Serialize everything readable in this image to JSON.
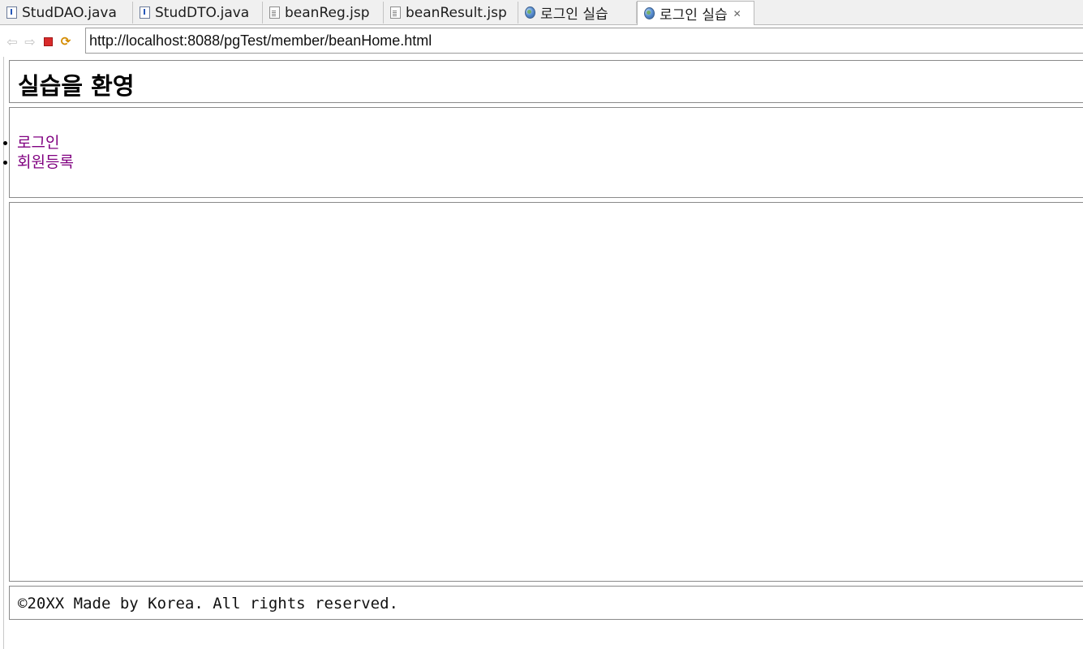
{
  "tabs": [
    {
      "label": "StudDAO.java",
      "icon": "java-file-icon"
    },
    {
      "label": "StudDTO.java",
      "icon": "java-file-icon"
    },
    {
      "label": "beanReg.jsp",
      "icon": "jsp-file-icon"
    },
    {
      "label": "beanResult.jsp",
      "icon": "jsp-file-icon"
    },
    {
      "label": "로그인 실습",
      "icon": "globe-icon"
    },
    {
      "label": "로그인 실습",
      "icon": "globe-icon",
      "active": true,
      "close_icon": "close-icon"
    }
  ],
  "toolbar": {
    "back_icon": "back-arrow-icon",
    "forward_icon": "forward-arrow-icon",
    "stop_icon": "stop-icon",
    "refresh_icon": "refresh-icon",
    "url": "http://localhost:8088/pgTest/member/beanHome.html"
  },
  "page": {
    "header_title": "실습을 환영",
    "menu_items": [
      "로그인",
      "회원등록"
    ],
    "link_color": "#800080",
    "footer_text": "©20XX Made by Korea. All rights reserved."
  }
}
